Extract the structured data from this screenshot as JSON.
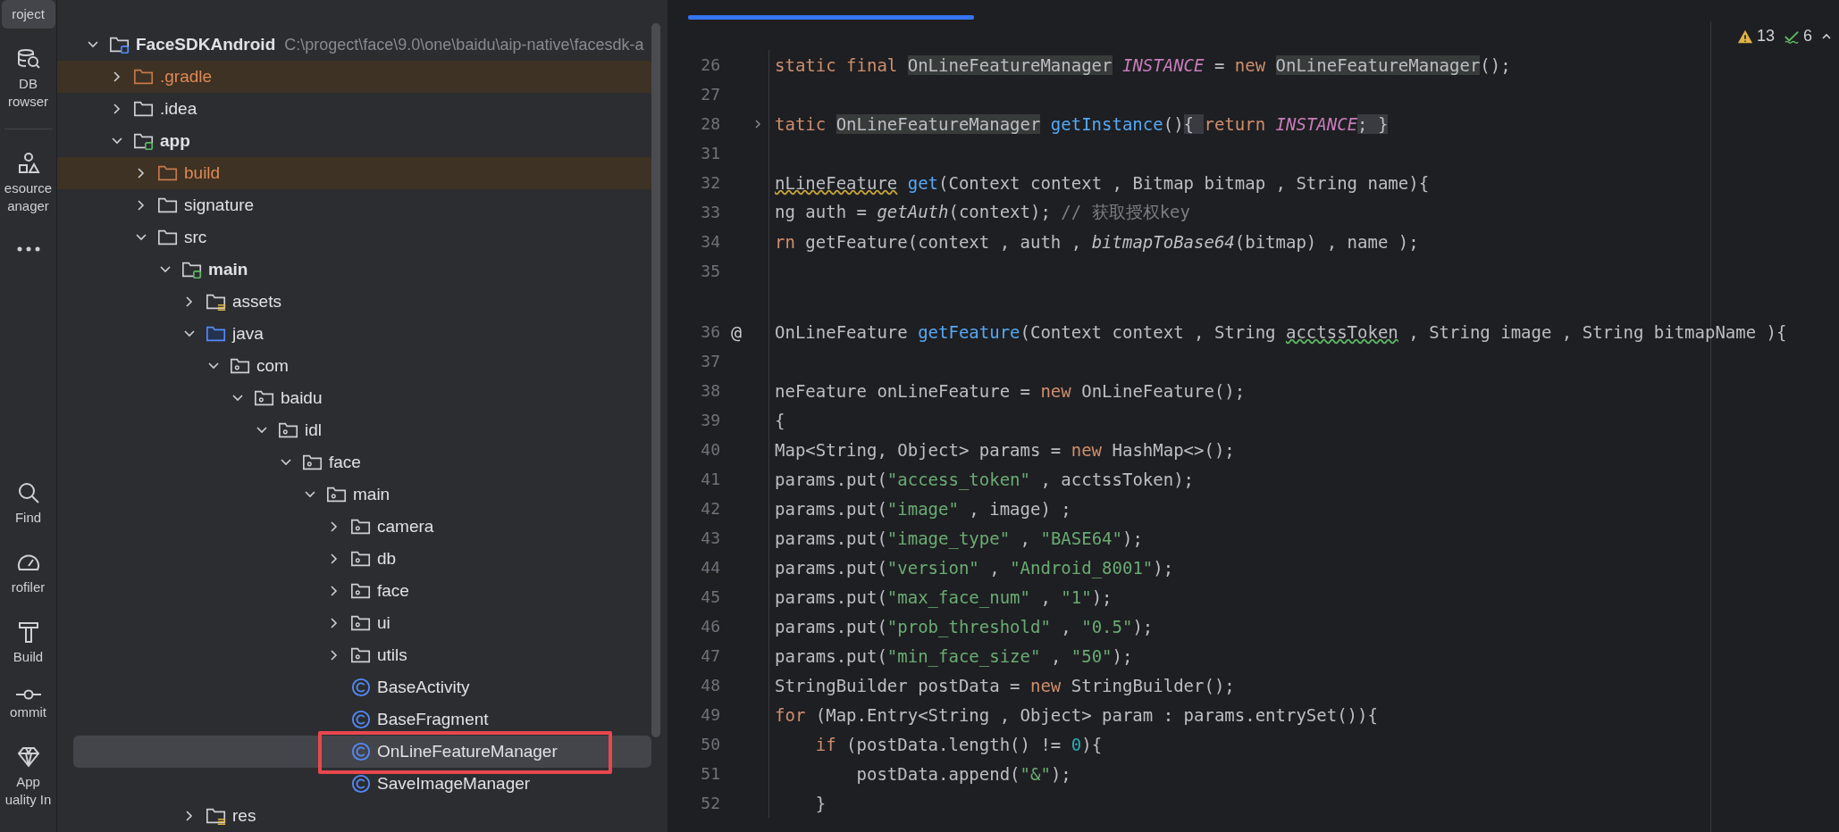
{
  "tool_rail": {
    "top": [
      {
        "kind": "project",
        "label": "roject",
        "selected": true
      },
      {
        "kind": "database",
        "label": "DB\nrowser",
        "selected": false
      },
      {
        "kind": "resources",
        "label": "esource\nanager",
        "selected": false
      },
      {
        "kind": "more",
        "selected": false
      }
    ],
    "bottom": [
      {
        "kind": "find",
        "label": "Find",
        "selected": false
      },
      {
        "kind": "profiler",
        "label": "rofiler",
        "selected": false
      },
      {
        "kind": "build",
        "label": "Build",
        "selected": false
      },
      {
        "kind": "commit",
        "label": "ommit",
        "selected": false
      },
      {
        "kind": "quality",
        "label": "App\nuality In",
        "selected": false
      }
    ]
  },
  "project_tree": [
    {
      "name": "FaceSDKAndroid",
      "path": "C:\\progect\\face\\9.0\\one\\baidu\\aip-native\\facesdk-a",
      "kind": "project",
      "expanded": true,
      "selected": false,
      "children": [
        {
          "name": ".gradle",
          "kind": "excluded",
          "expanded": false,
          "selected": false
        },
        {
          "name": ".idea",
          "kind": "folder",
          "expanded": false,
          "selected": false
        },
        {
          "name": "app",
          "kind": "module",
          "expanded": true,
          "selected": false,
          "children": [
            {
              "name": "build",
              "kind": "excluded",
              "expanded": false,
              "selected": false
            },
            {
              "name": "signature",
              "kind": "folder",
              "expanded": false,
              "selected": false
            },
            {
              "name": "src",
              "kind": "folder",
              "expanded": true,
              "selected": false,
              "children": [
                {
                  "name": "main",
                  "kind": "module",
                  "expanded": true,
                  "selected": false,
                  "children": [
                    {
                      "name": "assets",
                      "kind": "resources",
                      "expanded": false,
                      "selected": false
                    },
                    {
                      "name": "java",
                      "kind": "source-root",
                      "expanded": true,
                      "selected": false,
                      "children": [
                        {
                          "name": "com",
                          "kind": "package",
                          "expanded": true,
                          "selected": false,
                          "children": [
                            {
                              "name": "baidu",
                              "kind": "package",
                              "expanded": true,
                              "selected": false,
                              "children": [
                                {
                                  "name": "idl",
                                  "kind": "package",
                                  "expanded": true,
                                  "selected": false,
                                  "children": [
                                    {
                                      "name": "face",
                                      "kind": "package",
                                      "expanded": true,
                                      "selected": false,
                                      "children": [
                                        {
                                          "name": "main",
                                          "kind": "package",
                                          "expanded": true,
                                          "selected": false,
                                          "children": [
                                            {
                                              "name": "camera",
                                              "kind": "package",
                                              "expanded": false,
                                              "selected": false
                                            },
                                            {
                                              "name": "db",
                                              "kind": "package",
                                              "expanded": false,
                                              "selected": false
                                            },
                                            {
                                              "name": "face",
                                              "kind": "package",
                                              "expanded": false,
                                              "selected": false
                                            },
                                            {
                                              "name": "ui",
                                              "kind": "package",
                                              "expanded": false,
                                              "selected": false
                                            },
                                            {
                                              "name": "utils",
                                              "kind": "package",
                                              "expanded": false,
                                              "selected": false
                                            },
                                            {
                                              "name": "BaseActivity",
                                              "kind": "class",
                                              "selected": false
                                            },
                                            {
                                              "name": "BaseFragment",
                                              "kind": "class",
                                              "selected": false
                                            },
                                            {
                                              "name": "OnLineFeatureManager",
                                              "kind": "class",
                                              "selected": true,
                                              "annotated": true
                                            },
                                            {
                                              "name": "SaveImageManager",
                                              "kind": "class",
                                              "selected": false
                                            }
                                          ]
                                        }
                                      ]
                                    }
                                  ]
                                }
                              ]
                            }
                          ]
                        }
                      ]
                    },
                    {
                      "name": "res",
                      "kind": "resources",
                      "expanded": false,
                      "selected": false
                    }
                  ]
                }
              ]
            }
          ]
        }
      ]
    }
  ],
  "inspections": {
    "warnings": "13",
    "weak_warnings": "6"
  },
  "code_lines": [
    {
      "number": "26",
      "tokens": [
        {
          "kind": "keyword",
          "text": "static final "
        },
        {
          "kind": "usage",
          "text": "OnLineFeatureManager"
        },
        {
          "kind": "constant",
          "text": " INSTANCE"
        },
        {
          "kind": "plain",
          "text": " = "
        },
        {
          "kind": "keyword",
          "text": "new "
        },
        {
          "kind": "usage",
          "text": "OnLineFeatureManager"
        },
        {
          "kind": "plain",
          "text": "();"
        }
      ]
    },
    {
      "number": "27"
    },
    {
      "number": "28",
      "folded": true,
      "tokens": [
        {
          "kind": "keyword",
          "text": "tatic "
        },
        {
          "kind": "usage",
          "text": "OnLineFeatureManager"
        },
        {
          "kind": "method",
          "text": " getInstance"
        },
        {
          "kind": "plain",
          "text": "()"
        },
        {
          "kind": "folded",
          "text": "{ "
        },
        {
          "kind": "keyword",
          "text": "return "
        },
        {
          "kind": "constant",
          "text": "INSTANCE"
        },
        {
          "kind": "folded",
          "text": "; }"
        }
      ]
    },
    {
      "number": "31"
    },
    {
      "number": "32",
      "tokens": [
        {
          "kind": "warning",
          "text": "nLineFeature"
        },
        {
          "kind": "method",
          "text": " get"
        },
        {
          "kind": "plain",
          "text": "(Context context , Bitmap bitmap , String name){"
        }
      ]
    },
    {
      "number": "33",
      "tokens": [
        {
          "kind": "plain",
          "text": "ng auth = "
        },
        {
          "kind": "italic",
          "text": "getAuth"
        },
        {
          "kind": "plain",
          "text": "(context); "
        },
        {
          "kind": "comment",
          "text": "// 获取授权key"
        }
      ]
    },
    {
      "number": "34",
      "tokens": [
        {
          "kind": "keyword",
          "text": "rn "
        },
        {
          "kind": "plain",
          "text": "getFeature(context , auth , "
        },
        {
          "kind": "italic",
          "text": "bitmapToBase64"
        },
        {
          "kind": "plain",
          "text": "(bitmap) , name );"
        }
      ]
    },
    {
      "number": "35"
    },
    {
      "kind": "spacer"
    },
    {
      "number": "36",
      "gutter_mark": "@",
      "tokens": [
        {
          "kind": "plain",
          "text": "OnLineFeature "
        },
        {
          "kind": "method",
          "text": "getFeature"
        },
        {
          "kind": "plain",
          "text": "(Context context , String "
        },
        {
          "kind": "typo",
          "text": "acctssToken"
        },
        {
          "kind": "plain",
          "text": " , String image , String bitmapName ){"
        }
      ]
    },
    {
      "number": "37"
    },
    {
      "number": "38",
      "tokens": [
        {
          "kind": "plain",
          "text": "neFeature onLineFeature = "
        },
        {
          "kind": "keyword",
          "text": "new "
        },
        {
          "kind": "plain",
          "text": "OnLineFeature();"
        }
      ]
    },
    {
      "number": "39",
      "tokens": [
        {
          "kind": "plain",
          "text": "{"
        }
      ]
    },
    {
      "number": "40",
      "tokens": [
        {
          "kind": "plain",
          "text": "Map<String, Object> params = "
        },
        {
          "kind": "keyword",
          "text": "new "
        },
        {
          "kind": "plain",
          "text": "HashMap<>();"
        }
      ]
    },
    {
      "number": "41",
      "tokens": [
        {
          "kind": "plain",
          "text": "params.put("
        },
        {
          "kind": "string",
          "text": "\"access_token\""
        },
        {
          "kind": "plain",
          "text": " , acctssToken);"
        }
      ]
    },
    {
      "number": "42",
      "tokens": [
        {
          "kind": "plain",
          "text": "params.put("
        },
        {
          "kind": "string",
          "text": "\"image\""
        },
        {
          "kind": "plain",
          "text": " , image) ;"
        }
      ]
    },
    {
      "number": "43",
      "tokens": [
        {
          "kind": "plain",
          "text": "params.put("
        },
        {
          "kind": "string",
          "text": "\"image_type\""
        },
        {
          "kind": "plain",
          "text": " , "
        },
        {
          "kind": "string",
          "text": "\"BASE64\""
        },
        {
          "kind": "plain",
          "text": ");"
        }
      ]
    },
    {
      "number": "44",
      "tokens": [
        {
          "kind": "plain",
          "text": "params.put("
        },
        {
          "kind": "string",
          "text": "\"version\""
        },
        {
          "kind": "plain",
          "text": " , "
        },
        {
          "kind": "string",
          "text": "\"Android_8001\""
        },
        {
          "kind": "plain",
          "text": ");"
        }
      ]
    },
    {
      "number": "45",
      "tokens": [
        {
          "kind": "plain",
          "text": "params.put("
        },
        {
          "kind": "string",
          "text": "\"max_face_num\""
        },
        {
          "kind": "plain",
          "text": " , "
        },
        {
          "kind": "string",
          "text": "\"1\""
        },
        {
          "kind": "plain",
          "text": ");"
        }
      ]
    },
    {
      "number": "46",
      "tokens": [
        {
          "kind": "plain",
          "text": "params.put("
        },
        {
          "kind": "string",
          "text": "\"prob_threshold\""
        },
        {
          "kind": "plain",
          "text": " , "
        },
        {
          "kind": "string",
          "text": "\"0.5\""
        },
        {
          "kind": "plain",
          "text": ");"
        }
      ]
    },
    {
      "number": "47",
      "tokens": [
        {
          "kind": "plain",
          "text": "params.put("
        },
        {
          "kind": "string",
          "text": "\"min_face_size\""
        },
        {
          "kind": "plain",
          "text": " , "
        },
        {
          "kind": "string",
          "text": "\"50\""
        },
        {
          "kind": "plain",
          "text": ");"
        }
      ]
    },
    {
      "number": "48",
      "tokens": [
        {
          "kind": "plain",
          "text": "StringBuilder postData = "
        },
        {
          "kind": "keyword",
          "text": "new "
        },
        {
          "kind": "plain",
          "text": "StringBuilder();"
        }
      ]
    },
    {
      "number": "49",
      "tokens": [
        {
          "kind": "keyword",
          "text": "for "
        },
        {
          "kind": "plain",
          "text": "(Map.Entry<String , Object> param : params.entrySet()){"
        }
      ]
    },
    {
      "number": "50",
      "tokens": [
        {
          "kind": "keyword",
          "text": "    if "
        },
        {
          "kind": "plain",
          "text": "(postData.length() != "
        },
        {
          "kind": "number",
          "text": "0"
        },
        {
          "kind": "plain",
          "text": "){"
        }
      ]
    },
    {
      "number": "51",
      "tokens": [
        {
          "kind": "plain",
          "text": "        postData.append("
        },
        {
          "kind": "string",
          "text": "\"&\""
        },
        {
          "kind": "plain",
          "text": ");"
        }
      ]
    },
    {
      "number": "52",
      "tokens": [
        {
          "kind": "plain",
          "text": "    }"
        }
      ]
    }
  ]
}
